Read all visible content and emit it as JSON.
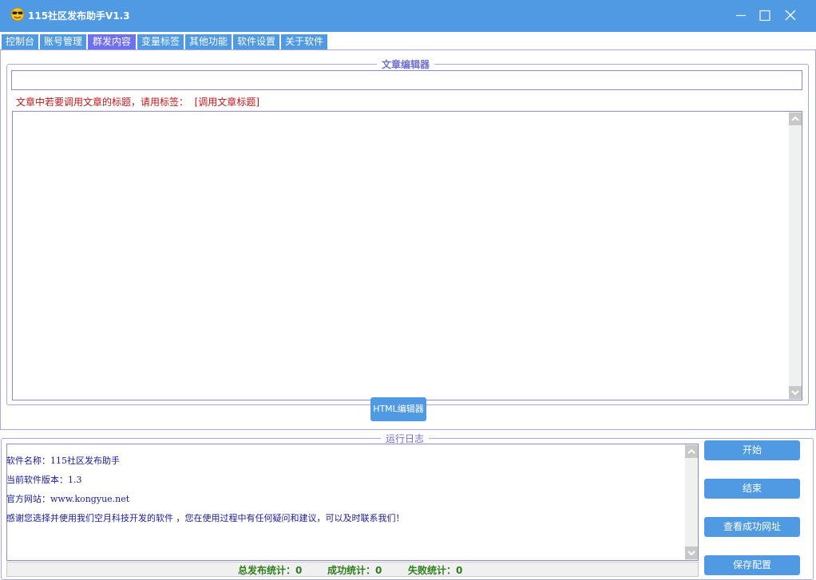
{
  "window": {
    "title": "115社区发布助手V1.3",
    "accent_color": "#4f9ae3",
    "active_tab_color": "#6f6ff2",
    "icons": {
      "app": "sunglasses-smiley-icon",
      "minimize": "minimize-icon",
      "maximize": "maximize-icon",
      "close": "close-icon"
    }
  },
  "tabs": [
    {
      "label": "控制台",
      "active": false
    },
    {
      "label": "账号管理",
      "active": false
    },
    {
      "label": "群发内容",
      "active": true
    },
    {
      "label": "变量标签",
      "active": false
    },
    {
      "label": "其他功能",
      "active": false
    },
    {
      "label": "软件设置",
      "active": false
    },
    {
      "label": "关于软件",
      "active": false
    }
  ],
  "editor": {
    "legend": "文章编辑器",
    "title_value": "",
    "tip": "文章中若要调用文章的标题，请用标签：  [调用文章标题]",
    "content_value": "",
    "html_editor_button": "HTML编辑器"
  },
  "log": {
    "legend": "运行日志",
    "lines": [
      "软件名称：115社区发布助手",
      "当前软件版本：1.3",
      "官方网站：www.kongyue.net",
      "感谢您选择并使用我们空月科技开发的软件 ，您在使用过程中有任何疑问和建议，可以及时联系我们！"
    ]
  },
  "stats": {
    "total": "总发布统计：0",
    "success": "成功统计：0",
    "fail": "失败统计：0"
  },
  "actions": {
    "start": "开始",
    "end": "结束",
    "view_success_urls": "查看成功网址",
    "save_config": "保存配置"
  }
}
